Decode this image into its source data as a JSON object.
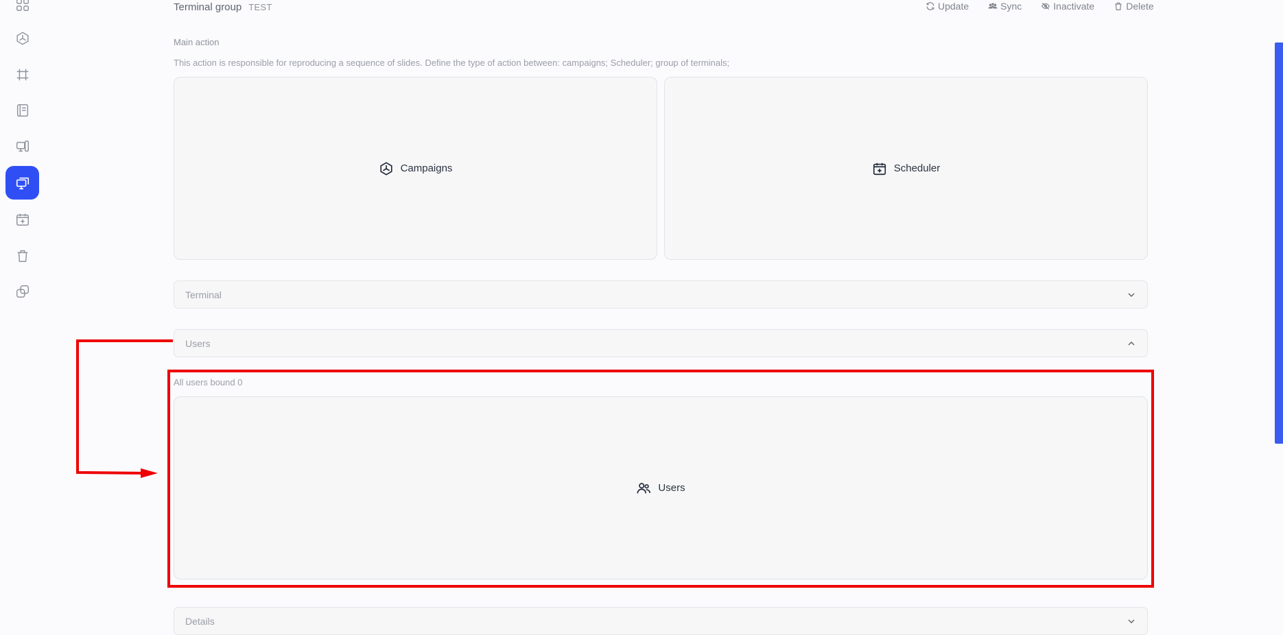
{
  "header": {
    "title": "Terminal group",
    "subtitle": "TEST",
    "actions": [
      {
        "label": "Update",
        "icon": "refresh-icon"
      },
      {
        "label": "Sync",
        "icon": "users-sync-icon"
      },
      {
        "label": "Inactivate",
        "icon": "eye-off-icon"
      },
      {
        "label": "Delete",
        "icon": "trash-icon"
      }
    ]
  },
  "sidebar": {
    "items": [
      {
        "icon": "dashboard-icon",
        "active": false
      },
      {
        "icon": "campaigns-icon",
        "active": false
      },
      {
        "icon": "crop-icon",
        "active": false
      },
      {
        "icon": "layout-icon",
        "active": false
      },
      {
        "icon": "devices-icon",
        "active": false
      },
      {
        "icon": "terminal-groups-icon",
        "active": true
      },
      {
        "icon": "calendar-plus-icon",
        "active": false
      },
      {
        "icon": "trash-icon",
        "active": false
      },
      {
        "icon": "copy-icon",
        "active": false
      }
    ]
  },
  "main_action": {
    "label": "Main action",
    "description": "This action is responsible for reproducing a sequence of slides. Define the type of action between: campaigns; Scheduler; group of terminals;",
    "options": [
      {
        "label": "Campaigns",
        "icon": "campaigns-icon"
      },
      {
        "label": "Scheduler",
        "icon": "calendar-plus-icon"
      }
    ]
  },
  "sections": {
    "terminal": "Terminal",
    "users": "Users",
    "details": "Details"
  },
  "users_panel": {
    "bound_label": "All users bound 0",
    "button_label": "Users",
    "icon": "users-icon"
  },
  "colors": {
    "accent": "#2f4ff5",
    "annotation": "#ee0000"
  }
}
